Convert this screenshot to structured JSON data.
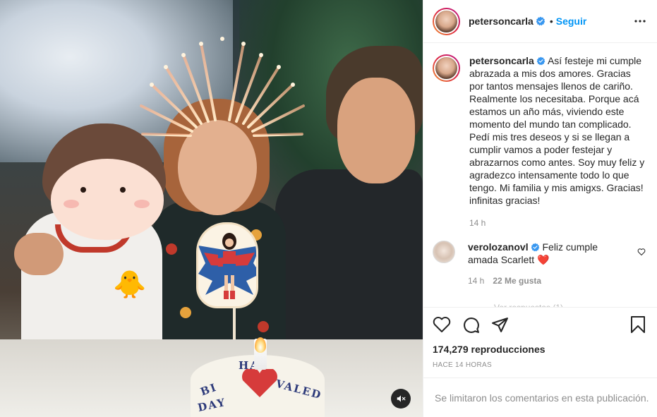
{
  "post": {
    "author": {
      "username": "petersoncarla",
      "verified": true,
      "follow_label": "Seguir",
      "separator": "•"
    },
    "media": {
      "type": "video",
      "overlay_emoji": "🐥",
      "cake_writing": [
        "BI",
        "HA",
        "DAY",
        "VALED"
      ],
      "mute_icon": "speaker-muted-icon"
    },
    "caption": {
      "username": "petersoncarla",
      "text": "Así festeje mi cumple abrazada a mis dos amores. Gracias por tantos mensajes llenos de cariño. Realmente los necesitaba. Porque acá estamos un año más, viviendo este momento del mundo tan complicado. Pedí mis tres deseos y si se llegan a cumplir vamos a poder festejar y abrazarnos como antes. Soy muy feliz y agradezco intensamente todo lo que tengo. Mi familia y mis amigxs. Gracias! infinitas gracias!",
      "time": "14 h"
    },
    "comments": [
      {
        "username": "verolozanovl",
        "verified": true,
        "text": "Feliz cumple amada Scarlett",
        "emoji": "❤️",
        "time": "14 h",
        "likes": "22 Me gusta",
        "view_replies": "Ver respuestas (1)"
      }
    ],
    "stats": {
      "views": "174,279 reproducciones",
      "timestamp": "HACE 14 HORAS"
    },
    "comments_limited": "Se limitaron los comentarios en esta publicación.",
    "colors": {
      "accent": "#0095f6",
      "verified": "#3897f0",
      "muted_text": "#8e8e8e",
      "heart_red": "#e0245e"
    }
  }
}
